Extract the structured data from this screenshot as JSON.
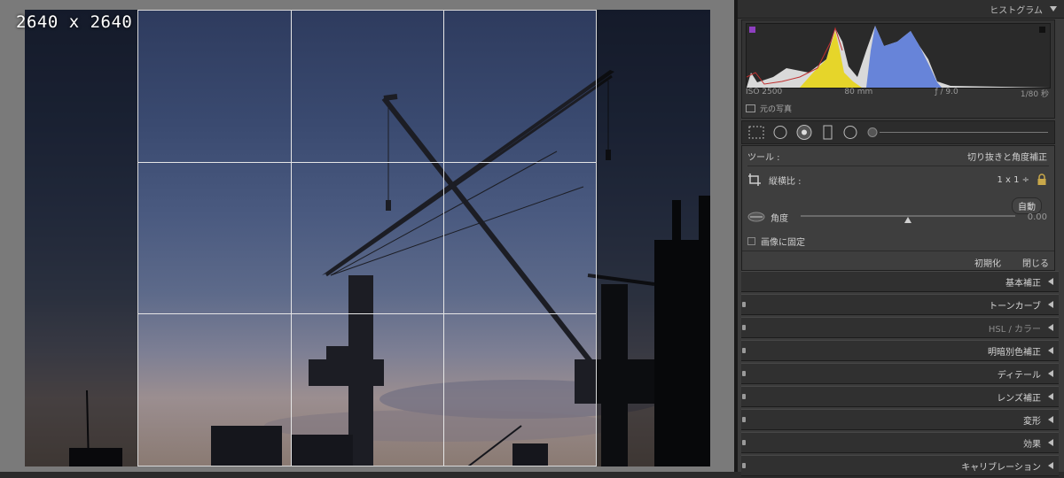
{
  "canvas": {
    "dimensions_label": "2640 x 2640"
  },
  "histogram": {
    "title": "ヒストグラム",
    "iso": "ISO 2500",
    "focal": "80 mm",
    "aperture": "ƒ / 9.0",
    "shutter": "1/80 秒",
    "original_label": "元の写真"
  },
  "crop_tool": {
    "tool_label": "ツール :",
    "tool_name": "切り抜きと角度補正",
    "aspect_label": "縦横比 :",
    "aspect_value": "1 x 1 ÷",
    "angle_label": "角度",
    "angle_value": "0.00",
    "angle_level": 0.5,
    "auto_button": "自動",
    "lock_to_image": "画像に固定",
    "reset": "初期化",
    "close": "閉じる"
  },
  "sections": [
    {
      "name": "基本補正"
    },
    {
      "name": "トーンカーブ"
    },
    {
      "name": "HSL / カラー"
    },
    {
      "name": "明暗別色補正"
    },
    {
      "name": "ディテール"
    },
    {
      "name": "レンズ補正"
    },
    {
      "name": "変形"
    },
    {
      "name": "効果"
    },
    {
      "name": "キャリブレーション"
    }
  ]
}
